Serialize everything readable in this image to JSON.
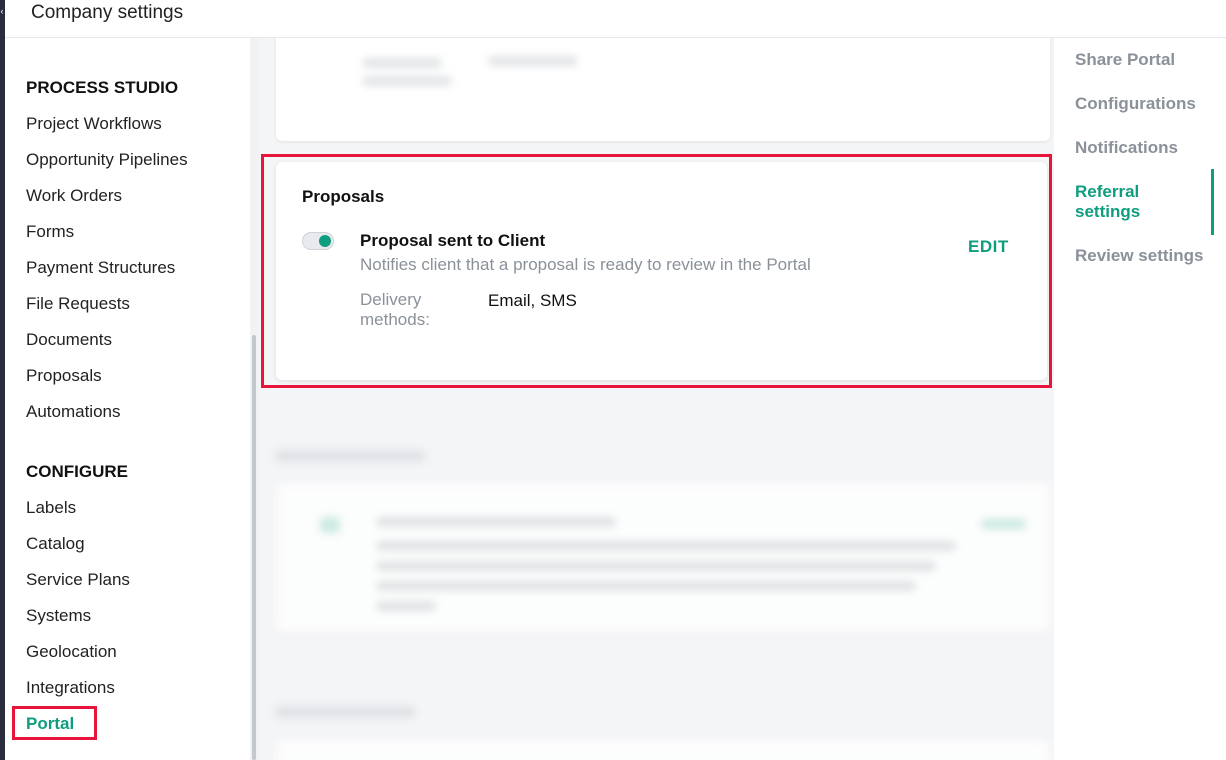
{
  "header": {
    "title": "Company settings",
    "collapse_icon": "chevron-left-icon"
  },
  "sidebar": {
    "sections": [
      {
        "heading": "PROCESS STUDIO",
        "items": [
          "Project Workflows",
          "Opportunity Pipelines",
          "Work Orders",
          "Forms",
          "Payment Structures",
          "File Requests",
          "Documents",
          "Proposals",
          "Automations"
        ]
      },
      {
        "heading": "CONFIGURE",
        "items": [
          "Labels",
          "Catalog",
          "Service Plans",
          "Systems",
          "Geolocation",
          "Integrations",
          "Portal"
        ]
      }
    ],
    "active_item": "Portal"
  },
  "proposals_card": {
    "title": "Proposals",
    "notification": {
      "title": "Proposal sent to Client",
      "description": "Notifies client that a proposal is ready to review in the Portal",
      "delivery_label": "Delivery methods:",
      "delivery_value": "Email, SMS",
      "enabled": true,
      "edit_label": "EDIT"
    }
  },
  "right_nav": {
    "items": [
      "Share Portal",
      "Configurations",
      "Notifications",
      "Referral settings",
      "Review settings"
    ],
    "active": "Referral settings"
  },
  "colors": {
    "accent": "#0f9d7f",
    "highlight": "#e8143c",
    "muted": "#8a9199"
  }
}
